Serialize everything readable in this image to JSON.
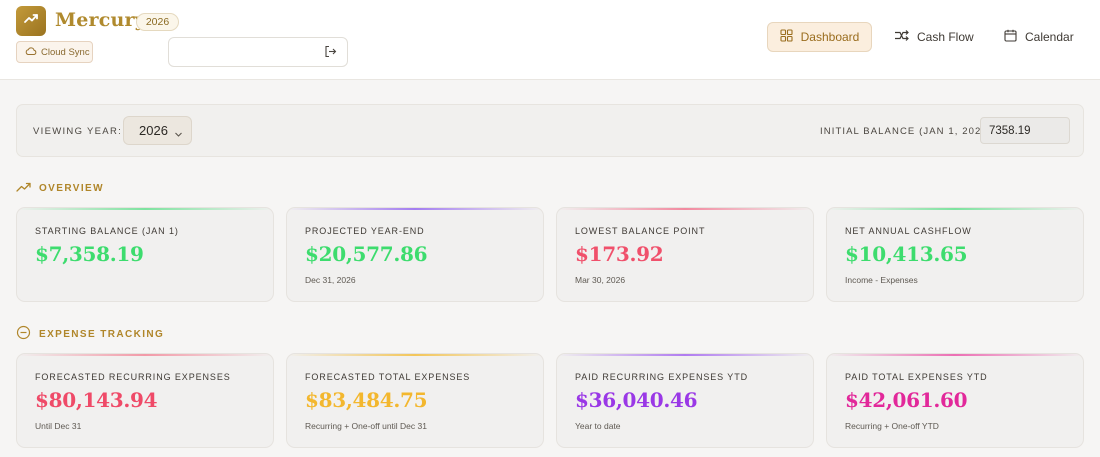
{
  "app": {
    "name": "Mercury",
    "year_badge": "2026",
    "sync_label": "Cloud Sync",
    "input_value": "",
    "input_placeholder": ""
  },
  "nav": {
    "dashboard": "Dashboard",
    "cash_flow": "Cash Flow",
    "calendar": "Calendar"
  },
  "controls": {
    "viewing_year_label": "VIEWING YEAR:",
    "viewing_year_value": "2026",
    "initial_balance_label": "INITIAL BALANCE (JAN 1, 2026):",
    "initial_balance_value": "7358.19"
  },
  "sections": {
    "overview": "OVERVIEW",
    "expense_tracking": "EXPENSE TRACKING"
  },
  "overview_cards": [
    {
      "label": "STARTING BALANCE (JAN 1)",
      "value": "$7,358.19",
      "sub": "",
      "color": "#3ddc6e",
      "accent": "#7ee3a0"
    },
    {
      "label": "PROJECTED YEAR-END",
      "value": "$20,577.86",
      "sub": "Dec 31, 2026",
      "color": "#3ddc6e",
      "accent": "#a47ef0"
    },
    {
      "label": "LOWEST BALANCE POINT",
      "value": "$173.92",
      "sub": "Mar 30, 2026",
      "color": "#f0506b",
      "accent": "#f28aa0"
    },
    {
      "label": "NET ANNUAL CASHFLOW",
      "value": "$10,413.65",
      "sub": "Income - Expenses",
      "color": "#3ddc6e",
      "accent": "#7ee3a0"
    }
  ],
  "expense_cards": [
    {
      "label": "FORECASTED RECURRING EXPENSES",
      "value": "$80,143.94",
      "sub": "Until Dec 31",
      "color": "#ef4a68",
      "accent": "#f29aa8"
    },
    {
      "label": "FORECASTED TOTAL EXPENSES",
      "value": "$83,484.75",
      "sub": "Recurring + One-off until Dec 31",
      "color": "#f3b72e",
      "accent": "#f3c65a"
    },
    {
      "label": "PAID RECURRING EXPENSES YTD",
      "value": "$36,040.46",
      "sub": "Year to date",
      "color": "#9a38e6",
      "accent": "#b07cf0"
    },
    {
      "label": "PAID TOTAL EXPENSES YTD",
      "value": "$42,061.60",
      "sub": "Recurring + One-off YTD",
      "color": "#e2289a",
      "accent": "#ec6fb4"
    }
  ]
}
